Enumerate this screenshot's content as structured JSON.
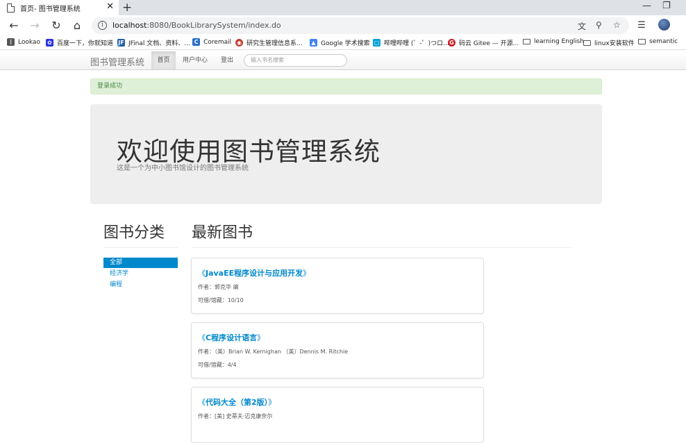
{
  "browser": {
    "tab_title": "首页- 图书管理系统",
    "tab_close": "✕",
    "new_tab": "+",
    "url_host": "localhost",
    "url_rest": ":8080/BookLibrarySystem/index.do",
    "bookmarks": [
      {
        "label": "Lookao",
        "icon": "grid-icon",
        "color": "#555555"
      },
      {
        "label": "百度一下，你就知道",
        "icon": "baidu-paw-icon",
        "color": "#2932e1"
      },
      {
        "label": "JFinal 文档、资料、...",
        "icon": "jfinal-icon",
        "color": "#1e5fa8"
      },
      {
        "label": "Coremail",
        "icon": "coremail-icon",
        "color": "#2a6fc9"
      },
      {
        "label": "研究生管理信息系...",
        "icon": "university-seal-icon",
        "color": "#c0392b"
      },
      {
        "label": "Google 学术搜索",
        "icon": "scholar-icon",
        "color": "#4285f4"
      },
      {
        "label": "哔哩哔哩 (゜-゜)つロ...",
        "icon": "bilibili-icon",
        "color": "#00a1d6"
      },
      {
        "label": "码云 Gitee — 开源...",
        "icon": "gitee-icon",
        "color": "#c71d23"
      },
      {
        "label": "learning English",
        "icon": "folder-icon",
        "color": "#555555"
      },
      {
        "label": "linux安装软件",
        "icon": "folder-icon",
        "color": "#555555"
      },
      {
        "label": "semantic",
        "icon": "folder-icon",
        "color": "#555555"
      }
    ]
  },
  "navbar": {
    "brand": "图书管理系统",
    "items": [
      "首页",
      "用户中心",
      "登出"
    ],
    "search_placeholder": "输入书名搜索"
  },
  "alert": "登录成功",
  "hero": {
    "title": "欢迎使用图书管理系统",
    "subtitle": "这是一个为中小图书馆设计的图书管理系统"
  },
  "sidebar": {
    "heading": "图书分类",
    "categories": [
      "全部",
      "经济学",
      "编程"
    ],
    "active_index": 0
  },
  "main": {
    "heading": "最新图书",
    "books": [
      {
        "title_pre": "《",
        "title": "JavaEE程序设计与应用开发",
        "title_post": "》",
        "author": "作者：郭克华 编",
        "stock": "可借/馆藏：10/10"
      },
      {
        "title_pre": "《",
        "title": "C程序设计语言",
        "title_post": "》",
        "author": "作者：（美）Brian W. Kernighan （美）Dennis M. Ritchie",
        "stock": "可借/馆藏：4/4"
      },
      {
        "title_pre": "《",
        "title": "代码大全（第2版）",
        "title_post": "》",
        "author": "作者：[美] 史蒂夫·迈克康奈尔",
        "stock": ""
      }
    ]
  },
  "colors": {
    "link": "#0088cc",
    "alert_bg": "#dff0d8",
    "alert_text": "#468847",
    "hero_bg": "#eeeeee"
  }
}
